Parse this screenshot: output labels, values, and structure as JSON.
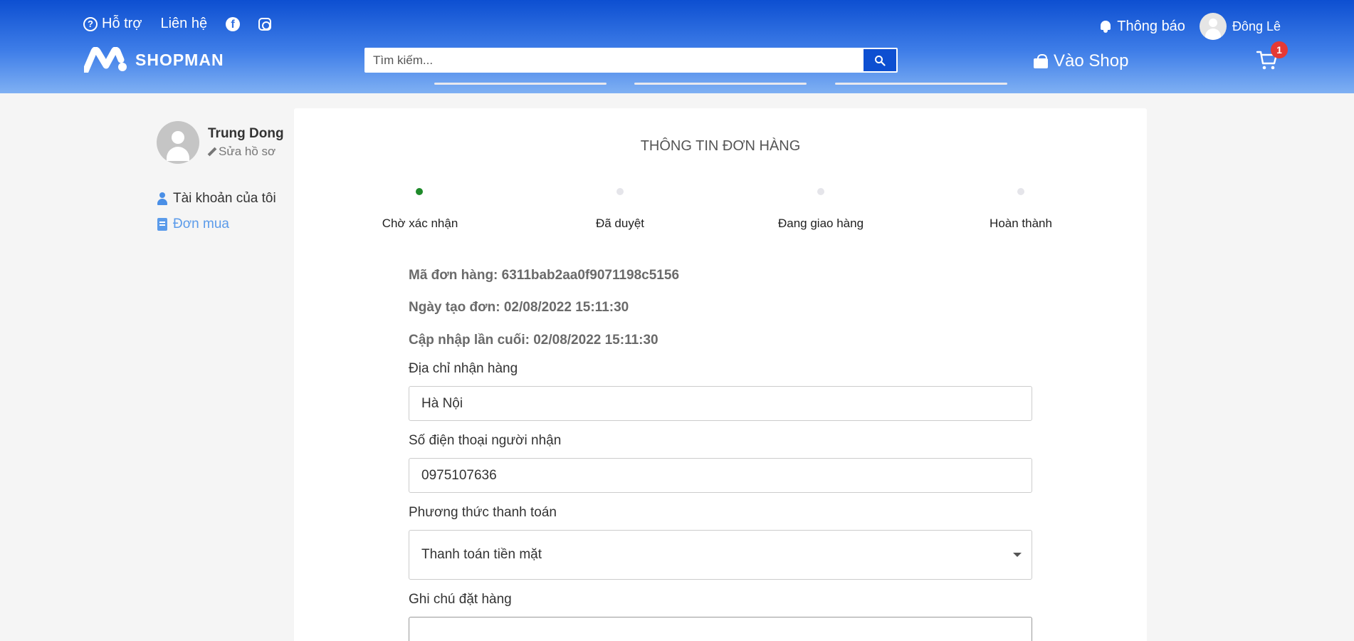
{
  "header": {
    "help_label": "Hỗ trợ",
    "contact_label": "Liên hệ",
    "notifications_label": "Thông báo",
    "user_name": "Đông Lê",
    "logo_text": "SHOPMAN",
    "search_placeholder": "Tìm kiếm...",
    "shop_label": "Vào Shop",
    "cart_count": "1"
  },
  "sidebar": {
    "profile_name": "Trung Dong",
    "edit_profile_label": "Sửa hồ sơ",
    "items": [
      {
        "label": "Tài khoản của tôi",
        "icon": "user-icon",
        "active": false
      },
      {
        "label": "Đơn mua",
        "icon": "document-icon",
        "active": true
      }
    ]
  },
  "order": {
    "title": "THÔNG TIN ĐƠN HÀNG",
    "steps": [
      {
        "label": "Chờ xác nhận",
        "active": true
      },
      {
        "label": "Đã duyệt",
        "active": false
      },
      {
        "label": "Đang giao hàng",
        "active": false
      },
      {
        "label": "Hoàn thành",
        "active": false
      }
    ],
    "order_id_text": "Mã đơn hàng: 6311bab2aa0f9071198c5156",
    "created_text": "Ngày tạo đơn: 02/08/2022 15:11:30",
    "updated_text": "Cập nhập lần cuối: 02/08/2022 15:11:30",
    "address_label": "Địa chỉ nhận hàng",
    "address_value": "Hà Nội",
    "phone_label": "Số điện thoại người nhận",
    "phone_value": "0975107636",
    "payment_label": "Phương thức thanh toán",
    "payment_value": "Thanh toán tiền mặt",
    "note_label": "Ghi chú đặt hàng",
    "note_value": ""
  },
  "colors": {
    "brand_blue": "#0d4fd1",
    "active_step": "#1e8a2a",
    "badge_red": "#e53935",
    "sidebar_active": "#5b9bea"
  }
}
